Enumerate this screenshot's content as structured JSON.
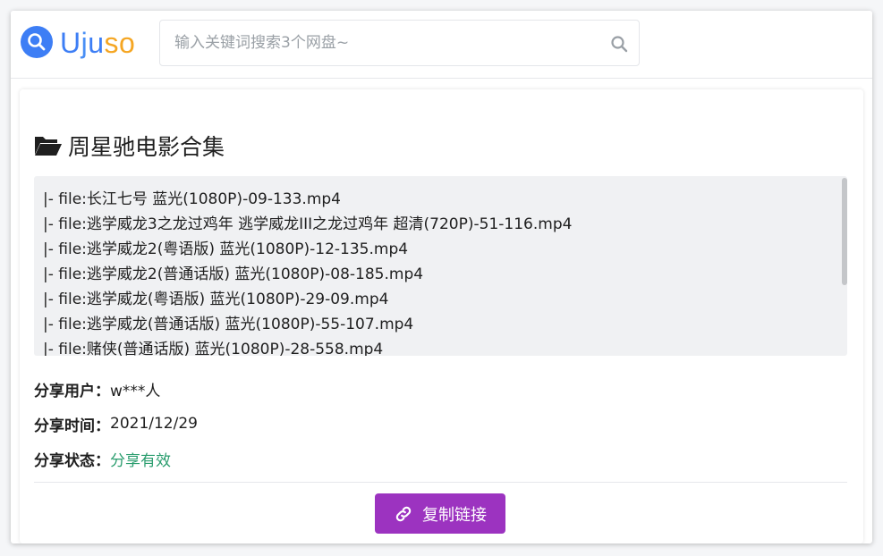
{
  "brand": {
    "letters": [
      "U",
      "j",
      "u",
      "so"
    ],
    "colors": {
      "primary": "#3d7ef5",
      "accent": "#f5a623"
    },
    "icon": "search-icon"
  },
  "search": {
    "placeholder": "输入关键词搜索3个网盘~",
    "value": "",
    "icon": "search-icon"
  },
  "resource": {
    "folder_icon": "folder-open-icon",
    "title": "周星驰电影合集",
    "files": [
      "|- file:长江七号 蓝光(1080P)-09-133.mp4",
      "|- file:逃学威龙3之龙过鸡年 逃学威龙III之龙过鸡年 超清(720P)-51-116.mp4",
      "|- file:逃学威龙2(粤语版) 蓝光(1080P)-12-135.mp4",
      "|- file:逃学威龙2(普通话版) 蓝光(1080P)-08-185.mp4",
      "|- file:逃学威龙(粤语版) 蓝光(1080P)-29-09.mp4",
      "|- file:逃学威龙(普通话版) 蓝光(1080P)-55-107.mp4",
      "|- file:赌侠(普通话版) 蓝光(1080P)-28-558.mp4"
    ],
    "share_user_label": "分享用户：",
    "share_user_value": "w***人",
    "share_time_label": "分享时间：",
    "share_time_value": "2021/12/29",
    "share_status_label": "分享状态：",
    "share_status_value": "分享有效",
    "status_color": "#2a9d6e"
  },
  "actions": {
    "copy_link_label": "复制链接",
    "copy_link_icon": "link-icon",
    "button_color": "#9c33c0"
  }
}
